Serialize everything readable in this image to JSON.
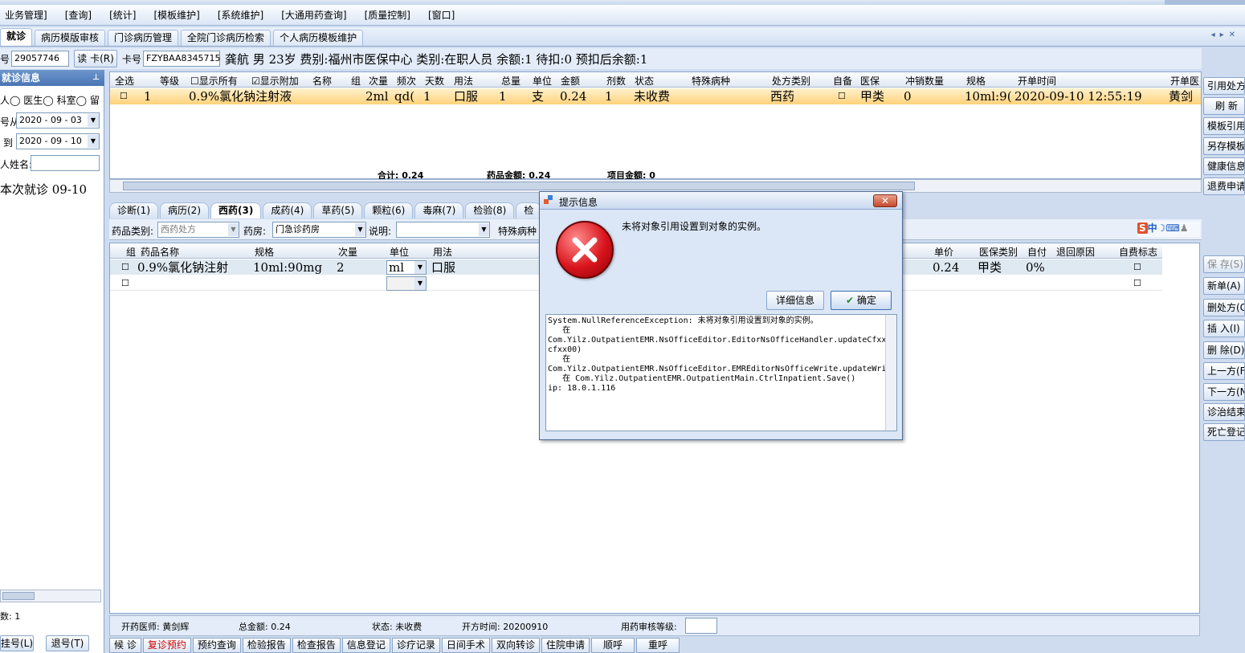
{
  "menu": [
    "业务管理]",
    "[查询]",
    "[统计]",
    "[模板维护]",
    "[系统维护]",
    "[大通用药查询]",
    "[质量控制]",
    "[窗口]"
  ],
  "tabs": [
    "就诊",
    "病历模版审核",
    "门诊病历管理",
    "全院门诊病历检索",
    "个人病历模板维护"
  ],
  "tab_nav": "◂▸✕",
  "patient": {
    "no_label": "号",
    "no_value": "29057746",
    "read_card": "读 卡(R)",
    "card_label": "卡号",
    "card_value": "FZYBAA8345715",
    "summary": "龚航 男 23岁 费别:福州市医保中心 类别:在职人员 余额:1 待扣:0 预扣后余额:1"
  },
  "left": {
    "header": "就诊信息",
    "radios": [
      "人",
      "医生",
      "科室",
      "留"
    ],
    "from_label": "号从",
    "from_date": "2020 - 09 - 03",
    "to_label": "到",
    "to_date": "2020 - 09 - 10",
    "name_label": "人姓名:",
    "visit_item": "本次就诊  09-10",
    "count_label": "数: 1",
    "reg_btn": "挂号(L)",
    "unreg_btn": "退号(T)"
  },
  "top_grid": {
    "headers": [
      "全选",
      "等级",
      "显示所有",
      "显示附加",
      "名称",
      "组",
      "次量",
      "频次",
      "天数",
      "用法",
      "总量",
      "单位",
      "金额",
      "剂数",
      "状态",
      "特殊病种",
      "处方类别",
      "自备",
      "医保",
      "冲销数量",
      "规格",
      "开单时间",
      "开单医"
    ],
    "row": [
      "1",
      "0.9%氯化钠注射液",
      "2ml",
      "qd(",
      "1",
      "口服",
      "1",
      "支",
      "0.24",
      "1",
      "未收费",
      "西药",
      "甲类",
      "0",
      "10ml:9(",
      "2020-09-10 12:55:19",
      "黄剑"
    ],
    "totals": {
      "sum": "合计: 0.24",
      "drug": "药品金额: 0.24",
      "item": "项目金额: 0"
    }
  },
  "mid_tabs": [
    "诊断(1)",
    "病历(2)",
    "西药(3)",
    "成药(4)",
    "草药(5)",
    "颗粒(6)",
    "毒麻(7)",
    "检验(8)",
    "检"
  ],
  "filter": {
    "drug_type_label": "药品类别:",
    "drug_type": "西药处方",
    "pharmacy_label": "药房:",
    "pharmacy": "门急诊药房",
    "note_label": "说明:",
    "special_label": "特殊病种"
  },
  "bottom_grid": {
    "headers": [
      "组",
      "药品名称",
      "规格",
      "次量",
      "单位",
      "用法",
      "单价",
      "医保类别",
      "自付",
      "退回原因",
      "自费标志"
    ],
    "row": [
      "0.9%氯化钠注射",
      "10ml:90mg",
      "2",
      "ml",
      "口服",
      "0.24",
      "甲类",
      "0%"
    ]
  },
  "status": {
    "doctor": "开药医师: 黄剑辉",
    "total": "总金额: 0.24",
    "state": "状态: 未收费",
    "time": "开方时间: 20200910",
    "review": "用药审核等级:"
  },
  "bottom_buttons": [
    "候 诊",
    "复诊预约",
    "预约查询",
    "检验报告",
    "检查报告",
    "信息登记",
    "诊疗记录",
    "日间手术",
    "双向转诊",
    "住院申请",
    "顺呼",
    "重呼"
  ],
  "right_buttons": [
    "引用处方",
    "刷 新",
    "模板引用",
    "另存模板",
    "健康信息",
    "退费申请",
    "保 存(S)",
    "新单(A)",
    "删处方(C)",
    "插 入(I)",
    "删 除(D)",
    "上一方(F)",
    "下一方(N)",
    "诊治结束",
    "死亡登记"
  ],
  "dialog": {
    "title": "提示信息",
    "close": "✕",
    "message": "未将对象引用设置到对象的实例。",
    "detail_btn": "详细信息",
    "ok_btn": "确定",
    "detail": "System.NullReferenceException: 未将对象引用设置到对象的实例。\n   在\nCom.Yilz.OutpatientEMR.NsOfficeEditor.EditorNsOfficeHandler.updateCfxx(String cfxx00)\n   在\nCom.Yilz.OutpatientEMR.NsOfficeEditor.EMREditorNsOfficeWrite.updateWriteDiagnoses()\n   在 Com.Yilz.OutpatientEMR.OutpatientMain.CtrlInpatient.Save()\nip: 18.0.1.116"
  },
  "ime": "中"
}
